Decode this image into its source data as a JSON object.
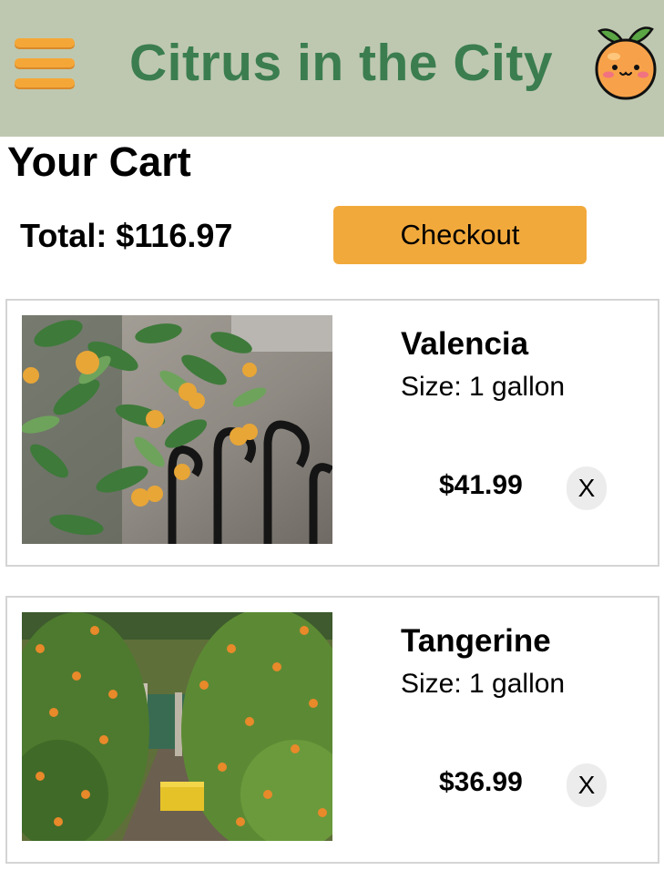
{
  "header": {
    "title": "Citrus in the City",
    "menu_icon": "hamburger-menu-icon",
    "logo_icon": "kawaii-orange-logo-icon",
    "background_color": "#bec8b0",
    "title_color": "#3b7d4f",
    "accent_color": "#f4a737"
  },
  "cart": {
    "title": "Your Cart",
    "total_label": "Total: $116.97",
    "checkout_label": "Checkout",
    "checkout_color": "#f2a93b",
    "items": [
      {
        "name": "Valencia",
        "size": "Size: 1 gallon",
        "price": "$41.99",
        "remove_label": "X",
        "image": "valencia-orange-tree-photo"
      },
      {
        "name": "Tangerine",
        "size": "Size: 1 gallon",
        "price": "$36.99",
        "remove_label": "X",
        "image": "tangerine-grove-photo"
      }
    ]
  }
}
